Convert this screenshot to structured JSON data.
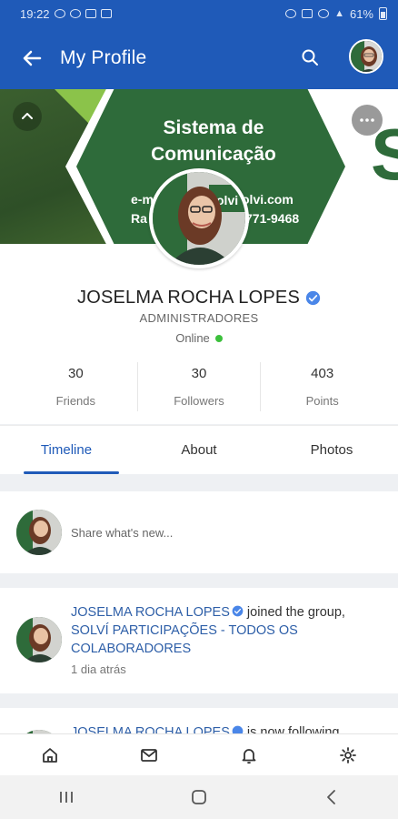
{
  "status_bar": {
    "time": "19:22",
    "battery": "61%"
  },
  "app_bar": {
    "title": "My Profile",
    "back_icon": "arrow-left-icon",
    "search_icon": "search-icon"
  },
  "cover": {
    "title_line1": "Sistema de",
    "title_line2": "Comunicação",
    "email_fragment_left": "e-m",
    "email_fragment_right": "olvi.com",
    "phone_fragment_left": "Ra",
    "phone_fragment_right": "771-9468",
    "brand_letter": "S"
  },
  "profile": {
    "name": "JOSELMA ROCHA  LOPES",
    "role": "ADMINISTRADORES",
    "status": "Online",
    "stats": [
      {
        "value": "30",
        "label": "Friends"
      },
      {
        "value": "30",
        "label": "Followers"
      },
      {
        "value": "403",
        "label": "Points"
      }
    ]
  },
  "tabs": [
    {
      "label": "Timeline",
      "active": true
    },
    {
      "label": "About",
      "active": false
    },
    {
      "label": "Photos",
      "active": false
    }
  ],
  "composer": {
    "placeholder": "Share what's new..."
  },
  "activity": {
    "actor": "JOSELMA ROCHA  LOPES",
    "action": "joined the group,",
    "group": "SOLVÍ PARTICIPAÇÕES - TODOS OS COLABORADORES",
    "time": "1 dia atrás"
  },
  "activity2": {
    "actor": "JOSELMA ROCHA  LOPES",
    "action": "is now following"
  },
  "bottom_nav": [
    "home-icon",
    "mail-icon",
    "bell-icon",
    "gear-icon"
  ],
  "colors": {
    "brand_blue": "#1f5ab8",
    "brand_green": "#2e6b3a",
    "online_green": "#3cc03c"
  }
}
